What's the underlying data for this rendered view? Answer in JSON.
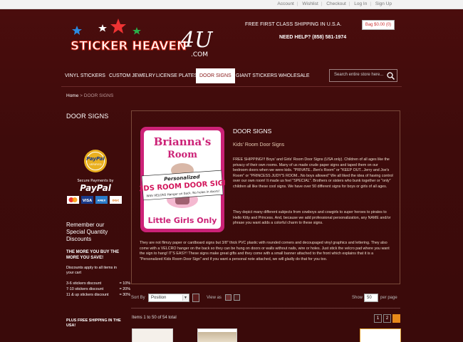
{
  "top_links": [
    "Account",
    "Wishlist",
    "Checkout",
    "Log In",
    "Sign Up"
  ],
  "logo": {
    "word1": "STICKER HEAVEN",
    "word2": "4U",
    "suffix": ".COM"
  },
  "header": {
    "shipping": "FREE FIRST CLASS SHIPPING IN U.S.A.",
    "help": "NEED HELP? (858) 581-1974",
    "bag": "Bag $0.00 (0)"
  },
  "nav": [
    "VINYL STICKERS",
    "CUSTOM JEWELRY",
    "LICENSE PLATES",
    "DOOR SIGNS",
    "GIANT STICKERS",
    "WHOLESALE"
  ],
  "search": {
    "placeholder": "Search entire store here..."
  },
  "breadcrumb": {
    "home": "Home",
    "sep": ">",
    "current": "DOOR SIGNS"
  },
  "sidebar": {
    "title": "DOOR SIGNS",
    "paypal": {
      "seal_line1": "PayPal",
      "seal_line2": "VERIFIED",
      "secure": "Secure Payments by",
      "brand": "PayPal",
      "cards": [
        "MC",
        "VISA",
        "AMEX",
        "DISC"
      ]
    },
    "remember": "Remember our Special Quantity Discounts",
    "more": "THE MORE YOU BUY THE MORE YOU SAVE!",
    "applies": "Discounts apply to all items in your cart",
    "tiers": [
      {
        "label": "3-6 stickers discount",
        "value": "= 10%"
      },
      {
        "label": "7-10 stickers discount",
        "value": "= 20%"
      },
      {
        "label": "11 & up stickers discount",
        "value": "= 30%"
      }
    ],
    "plus": "PLUS FREE SHIPPING IN THE USA!"
  },
  "sign": {
    "name": "Brianna's",
    "room": "Room",
    "personalized": "Personalized",
    "banner": "KIDS ROOM DOOR SIGN",
    "velcro": "With VELCRO Hanger on back. No holes in doors!",
    "bottom": "Little Girls Only"
  },
  "content": {
    "heading": "DOOR SIGNS",
    "subheading": "Kids' Room Door Signs",
    "p1": "FREE SHIPPING!!! Boys' and Girls' Room Door Signs (USA only). Children of all ages like the privacy of their own rooms. Many of us made crude paper signs and taped them on our bedroom doors when we were kids. \"PRIVATE...Ben's Room\" or \"KEEP OUT...Jerry and Joe's Room\" or \"PRINCESS JUDY'S ROOM...No boys allowed\" We all liked the idea of having control over our own room! It made us feel \"SPECIAL\". Brothers or sisters who bunk together or \"only\" children all like these cool signs. We have over 50 different signs for boys or girls of all ages.",
    "p2": "They depict many different subjects from cowboys and cowgirls to super heroes to pirates to Hello Kitty and Princess. And, because we add professional personalization, any NAME and/or phrase you want adds a colorful charm to these signs.",
    "p3": "They are not flimzy paper or cardboard signs but 3/8\" thick PVC plastic with rounded corners and decoupaged vinyl graphics and lettering. They also come with a VELCRO hanger on the back so they can be hung on doors or walls without nails, wire or holes. Just stick the velcro pad where you want the sign to hang! IT'S EASY! These signs make great gifts and they come with a small banner attached to the front which explains that it is a \"Personalized Kids Room Door Sign\" and if you want a personal note attached, we will gladly do that for you too."
  },
  "toolbar": {
    "sort_by": "Sort By",
    "sort_value": "Position",
    "view_as": "View as",
    "show": "Show",
    "show_value": "50",
    "per_page": "per page",
    "items": "Items 1 to 50 of 54 total",
    "pages": [
      "1",
      "2"
    ]
  },
  "colors": {
    "bg": "#3a0c0c",
    "accent": "#e8891a",
    "nav_active_text": "#8a1a1a",
    "sign_pink": "#cc2277"
  }
}
